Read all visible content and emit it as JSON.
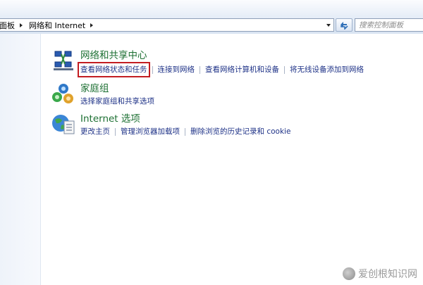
{
  "addressbar": {
    "crumbs": [
      "面板",
      "网络和 Internet"
    ],
    "search_placeholder": "搜索控制面板"
  },
  "categories": [
    {
      "title": "网络和共享中心",
      "icon": "network-center-icon",
      "links": [
        "查看网络状态和任务",
        "连接到网络",
        "查看网络计算机和设备",
        "将无线设备添加到网络"
      ],
      "highlighted_link": 0
    },
    {
      "title": "家庭组",
      "icon": "homegroup-icon",
      "links": [
        "选择家庭组和共享选项"
      ]
    },
    {
      "title": "Internet 选项",
      "icon": "internet-options-icon",
      "links": [
        "更改主页",
        "管理浏览器加载项",
        "删除浏览的历史记录和 cookie"
      ]
    }
  ],
  "watermark": {
    "text": "爱创根知识网"
  },
  "colors": {
    "link": "#1e3287",
    "category_title": "#1c6f32",
    "highlight_box": "#c31d22"
  }
}
